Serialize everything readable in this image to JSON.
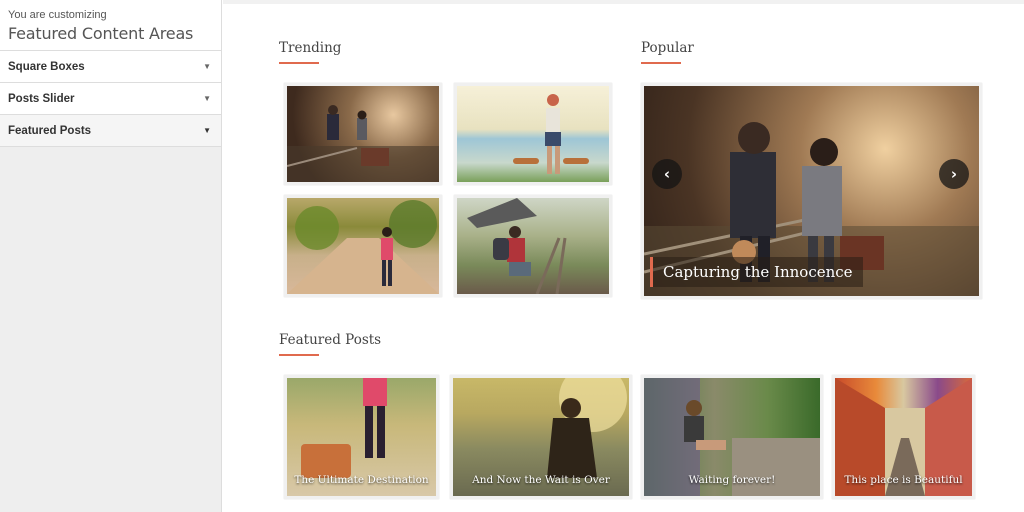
{
  "sidebar": {
    "customizing_label": "You are customizing",
    "title": "Featured Content Areas",
    "sections": [
      {
        "label": "Square Boxes"
      },
      {
        "label": "Posts Slider"
      },
      {
        "label": "Featured Posts"
      }
    ]
  },
  "preview": {
    "trending_heading": "Trending",
    "popular_heading": "Popular",
    "featured_heading": "Featured Posts",
    "popular_slider": {
      "caption": "Capturing the Innocence",
      "prev_glyph": "‹",
      "next_glyph": "›"
    },
    "featured_posts": [
      {
        "title": "The Ultimate Destination"
      },
      {
        "title": "And Now the Wait is Over"
      },
      {
        "title": "Waiting forever!"
      },
      {
        "title": "This place is Beautiful"
      }
    ]
  },
  "colors": {
    "accent": "#e06a4e",
    "sidebar_bg": "#eeeeee"
  },
  "icons": {
    "section_toggle": "triangle-down-icon",
    "slider_prev": "chevron-left-icon",
    "slider_next": "chevron-right-icon"
  }
}
